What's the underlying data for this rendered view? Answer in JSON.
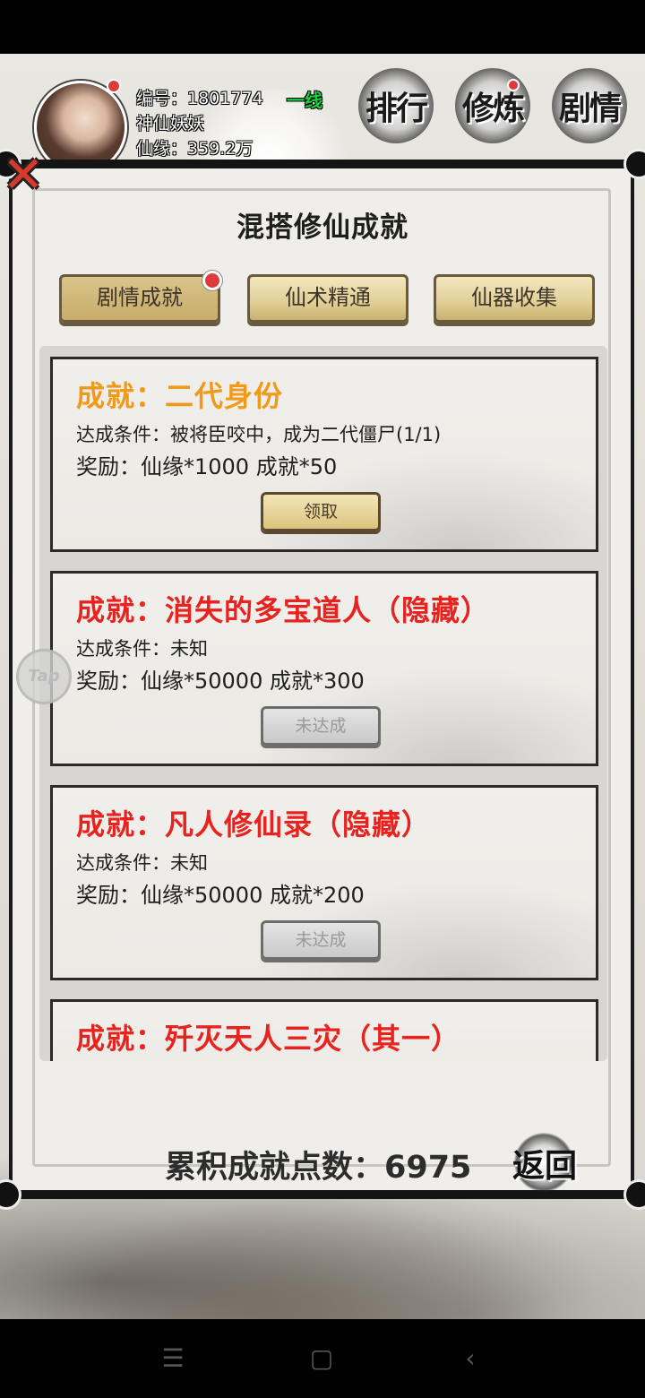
{
  "header": {
    "id_line": "编号：1801774",
    "name": "神仙妖妖",
    "currency_line": "仙缘：359.2万",
    "server": "一线",
    "nav": [
      {
        "label": "排行",
        "icon": "ink-blot-icon"
      },
      {
        "label": "修炼",
        "icon": "ink-blot-icon",
        "badge": true
      },
      {
        "label": "剧情",
        "icon": "ink-blot-icon"
      }
    ]
  },
  "panel": {
    "title": "混搭修仙成就",
    "close_icon": "close-x-icon",
    "tabs": [
      {
        "label": "剧情成就",
        "active": true,
        "badge": true
      },
      {
        "label": "仙术精通",
        "active": false
      },
      {
        "label": "仙器收集",
        "active": false
      }
    ],
    "achievements": [
      {
        "title": "成就：二代身份",
        "title_color": "#f09a1c",
        "condition": "达成条件：被将臣咬中，成为二代僵尸(1/1)",
        "reward": "奖励：仙缘*1000 成就*50",
        "button": "领取",
        "state": "claim"
      },
      {
        "title": "成就：消失的多宝道人（隐藏）",
        "title_color": "#e8231f",
        "condition": "达成条件：未知",
        "reward": "奖励：仙缘*50000 成就*300",
        "button": "未达成",
        "state": "locked"
      },
      {
        "title": "成就：凡人修仙录（隐藏）",
        "title_color": "#e8231f",
        "condition": "达成条件：未知",
        "reward": "奖励：仙缘*50000 成就*200",
        "button": "未达成",
        "state": "locked"
      },
      {
        "title": "成就：歼灭天人三灾（其一）",
        "title_color": "#e8231f"
      }
    ],
    "points_line": "累积成就点数：6975",
    "return_label": "返回"
  },
  "overlay": {
    "tap_label": "Tap"
  },
  "system_nav": {
    "menu_icon": "☰",
    "home_icon": "▢",
    "back_icon": "‹"
  }
}
